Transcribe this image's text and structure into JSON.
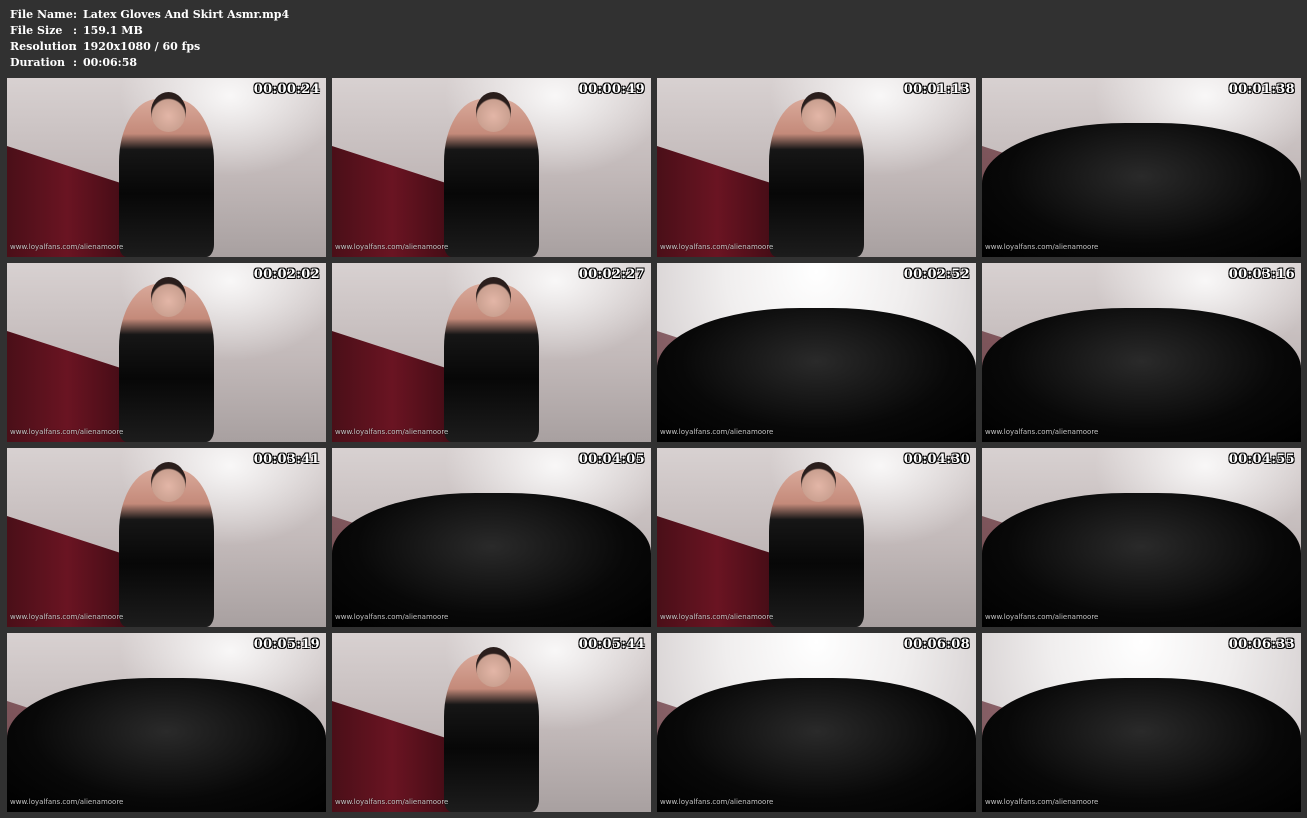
{
  "file_info": {
    "file_name": {
      "label": "File Name",
      "value": "Latex Gloves And Skirt Asmr.mp4"
    },
    "file_size": {
      "label": "File Size",
      "value": "159.1 MB"
    },
    "resolution": {
      "label": "Resolution",
      "value": "1920x1080 / 60 fps"
    },
    "duration": {
      "label": "Duration",
      "value": "00:06:58"
    }
  },
  "separator": ":",
  "watermark": "www.loyalfans.com/alienamoore",
  "thumbnails": [
    {
      "timestamp": "00:00:24",
      "style": "full"
    },
    {
      "timestamp": "00:00:49",
      "style": "full"
    },
    {
      "timestamp": "00:01:13",
      "style": "full"
    },
    {
      "timestamp": "00:01:38",
      "style": "closeup"
    },
    {
      "timestamp": "00:02:02",
      "style": "full"
    },
    {
      "timestamp": "00:02:27",
      "style": "full"
    },
    {
      "timestamp": "00:02:52",
      "style": "closeup-bright"
    },
    {
      "timestamp": "00:03:16",
      "style": "closeup"
    },
    {
      "timestamp": "00:03:41",
      "style": "full"
    },
    {
      "timestamp": "00:04:05",
      "style": "closeup"
    },
    {
      "timestamp": "00:04:30",
      "style": "full"
    },
    {
      "timestamp": "00:04:55",
      "style": "closeup"
    },
    {
      "timestamp": "00:05:19",
      "style": "closeup"
    },
    {
      "timestamp": "00:05:44",
      "style": "full"
    },
    {
      "timestamp": "00:06:08",
      "style": "closeup-bright"
    },
    {
      "timestamp": "00:06:33",
      "style": "closeup-bright"
    }
  ]
}
